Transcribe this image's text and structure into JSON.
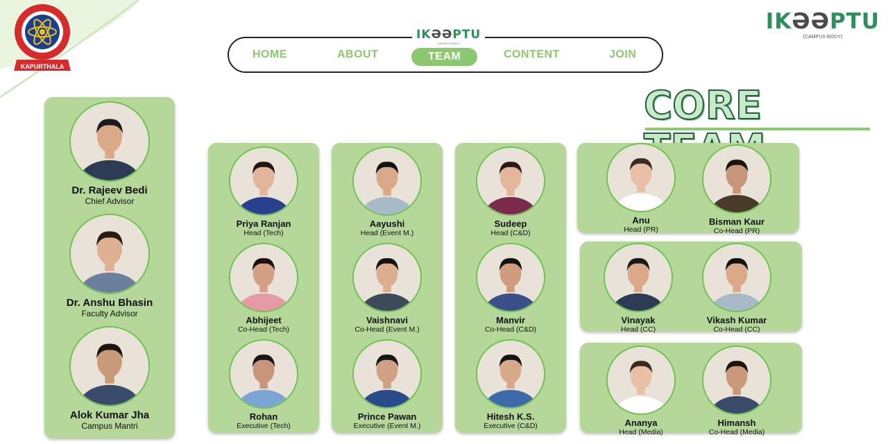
{
  "brand": {
    "name_left": "IK",
    "name_mid": "ƏƏ",
    "name_right": "PTU",
    "sub": "(CAMPUS BODY)"
  },
  "college_logo": {
    "caption": "KAPURTHALA",
    "icon": "university-emblem-icon"
  },
  "nav": {
    "items": [
      {
        "label": "HOME",
        "active": false
      },
      {
        "label": "ABOUT",
        "active": false
      },
      {
        "label": "TEAM",
        "active": true
      },
      {
        "label": "CONTENT",
        "active": false
      },
      {
        "label": "JOIN",
        "active": false
      }
    ]
  },
  "page_title": "CORE TEAM",
  "colors": {
    "panel": "#b5d89a",
    "accent": "#8bc870",
    "brand": "#2f8f5b"
  },
  "advisors": [
    {
      "name": "Dr. Rajeev Bedi",
      "role": "Chief Advisor"
    },
    {
      "name": "Dr. Anshu Bhasin",
      "role": "Faculty Advisor"
    },
    {
      "name": "Alok Kumar Jha",
      "role": "Campus Mantri"
    }
  ],
  "tech": [
    {
      "name": "Priya Ranjan",
      "role": "Head (Tech)"
    },
    {
      "name": "Abhijeet",
      "role": "Co-Head (Tech)"
    },
    {
      "name": "Rohan",
      "role": "Executive (Tech)"
    }
  ],
  "event": [
    {
      "name": "Aayushi",
      "role": "Head (Event M.)"
    },
    {
      "name": "Vaishnavi",
      "role": "Co-Head (Event M.)"
    },
    {
      "name": "Prince Pawan",
      "role": "Executive (Event M.)"
    }
  ],
  "cd": [
    {
      "name": "Sudeep",
      "role": "Head (C&D)"
    },
    {
      "name": "Manvir",
      "role": "Co-Head (C&D)"
    },
    {
      "name": "Hitesh K.S.",
      "role": "Executive (C&D)"
    }
  ],
  "pr": [
    {
      "name": "Anu",
      "role": "Head (PR)"
    },
    {
      "name": "Bisman Kaur",
      "role": "Co-Head (PR)"
    }
  ],
  "cc": [
    {
      "name": "Vinayak",
      "role": "Head (CC)"
    },
    {
      "name": "Vikash Kumar",
      "role": "Co-Head (CC)"
    }
  ],
  "media": [
    {
      "name": "Ananya",
      "role": "Head (Media)"
    },
    {
      "name": "Himansh",
      "role": "Co-Head (Media)"
    }
  ]
}
